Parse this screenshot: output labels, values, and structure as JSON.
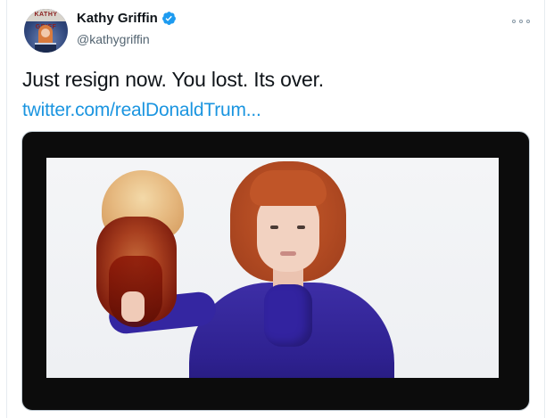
{
  "tweet": {
    "author_name": "Kathy Griffin",
    "author_handle": "@kathygriffin",
    "avatar_label": "KATHY GRIFF",
    "text": "Just resign now. You lost. Its over.",
    "link_text": "twitter.com/realDonaldTrum...",
    "verified": true
  },
  "icons": {
    "verified": "verified-badge-icon",
    "more": "more-options-icon"
  },
  "colors": {
    "link": "#1b95e0",
    "verified_badge": "#1d9bf0",
    "handle_text": "#536471",
    "media_background": "#0c0c0c"
  }
}
